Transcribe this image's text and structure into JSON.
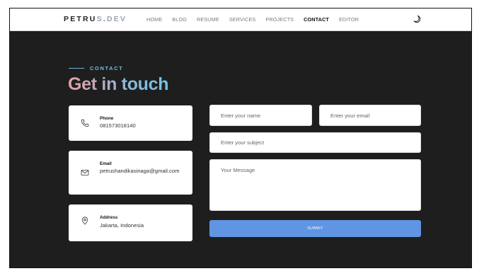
{
  "brand": {
    "part1": "PETRU",
    "part2": "S",
    "dot": ".",
    "part3": "DEV"
  },
  "nav": {
    "items": [
      {
        "label": "HOME"
      },
      {
        "label": "BLOG"
      },
      {
        "label": "RESUME"
      },
      {
        "label": "SERVICES"
      },
      {
        "label": "PROJECTS"
      },
      {
        "label": "CONTACT",
        "active": true
      },
      {
        "label": "EDITOR"
      }
    ],
    "theme_icon": "moon-icon"
  },
  "section": {
    "eyebrow": "CONTACT",
    "title": "Get in touch"
  },
  "info": {
    "phone": {
      "icon": "phone-icon",
      "label": "Phone",
      "value": "081573018140"
    },
    "email": {
      "icon": "mail-icon",
      "label": "Email",
      "value": "petrushandikasinaga@gmail.com"
    },
    "address": {
      "icon": "location-pin-icon",
      "label": "Address",
      "value": "Jakarta, Indonesia"
    }
  },
  "form": {
    "name_placeholder": "Enter your name",
    "email_placeholder": "Enter your email",
    "subject_placeholder": "Enter your subject",
    "message_placeholder": "Your Message",
    "submit_label": "SUBMIT"
  },
  "colors": {
    "page_bg": "#1e1e1e",
    "accent": "#74c0e0",
    "submit": "#5f95e2",
    "title_gradient_start": "#e3a4a6",
    "title_gradient_end": "#6ec4e6"
  }
}
